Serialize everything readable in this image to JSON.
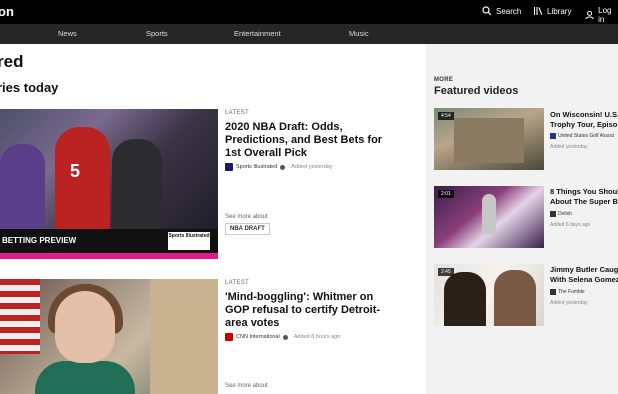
{
  "header": {
    "brand": "on",
    "search_label": "Search",
    "library_label": "Library",
    "login_label": "Log in"
  },
  "nav": [
    "News",
    "Sports",
    "Entertainment",
    "Music"
  ],
  "main": {
    "page_heading": "red",
    "section_heading": "ries today",
    "cards": [
      {
        "label": "LATEST",
        "headline": "2020 NBA Draft: Odds, Predictions, and Best Bets for 1st Overall Pick",
        "source": "Sports Illustrated",
        "added": "Added yesterday",
        "see_more": "See more about",
        "tag": "NBA DRAFT",
        "image_banner": "BETTING PREVIEW",
        "jersey_number": "5",
        "logo_text": "Sports Illustrated"
      },
      {
        "label": "LATEST",
        "headline": "'Mind-boggling': Whitmer on GOP refusal to certify Detroit-area votes",
        "source": "CNN International",
        "added": "Added 8 hours ago",
        "see_more": "See more about"
      }
    ]
  },
  "featured": {
    "more_label": "MORE",
    "title": "Featured videos",
    "videos": [
      {
        "duration": "4:54",
        "title_line1": "On Wisconsin! U.S.",
        "title_line2": "Trophy Tour, Episo",
        "source": "United States Golf Associ",
        "added": "Added yesterday"
      },
      {
        "duration": "2:01",
        "title_line1": "8 Things You Shoul",
        "title_line2": "About The Super B",
        "source": "Delish",
        "added": "Added 6 days ago"
      },
      {
        "duration": "2:45",
        "title_line1": "Jimmy Butler Caug",
        "title_line2": "With Selena Gomez",
        "source": "The Fumble",
        "added": "Added yesterday"
      }
    ]
  },
  "colors": {
    "topbar": "#000000",
    "navbar": "#262626",
    "accent_pink": "#e11b8f"
  }
}
